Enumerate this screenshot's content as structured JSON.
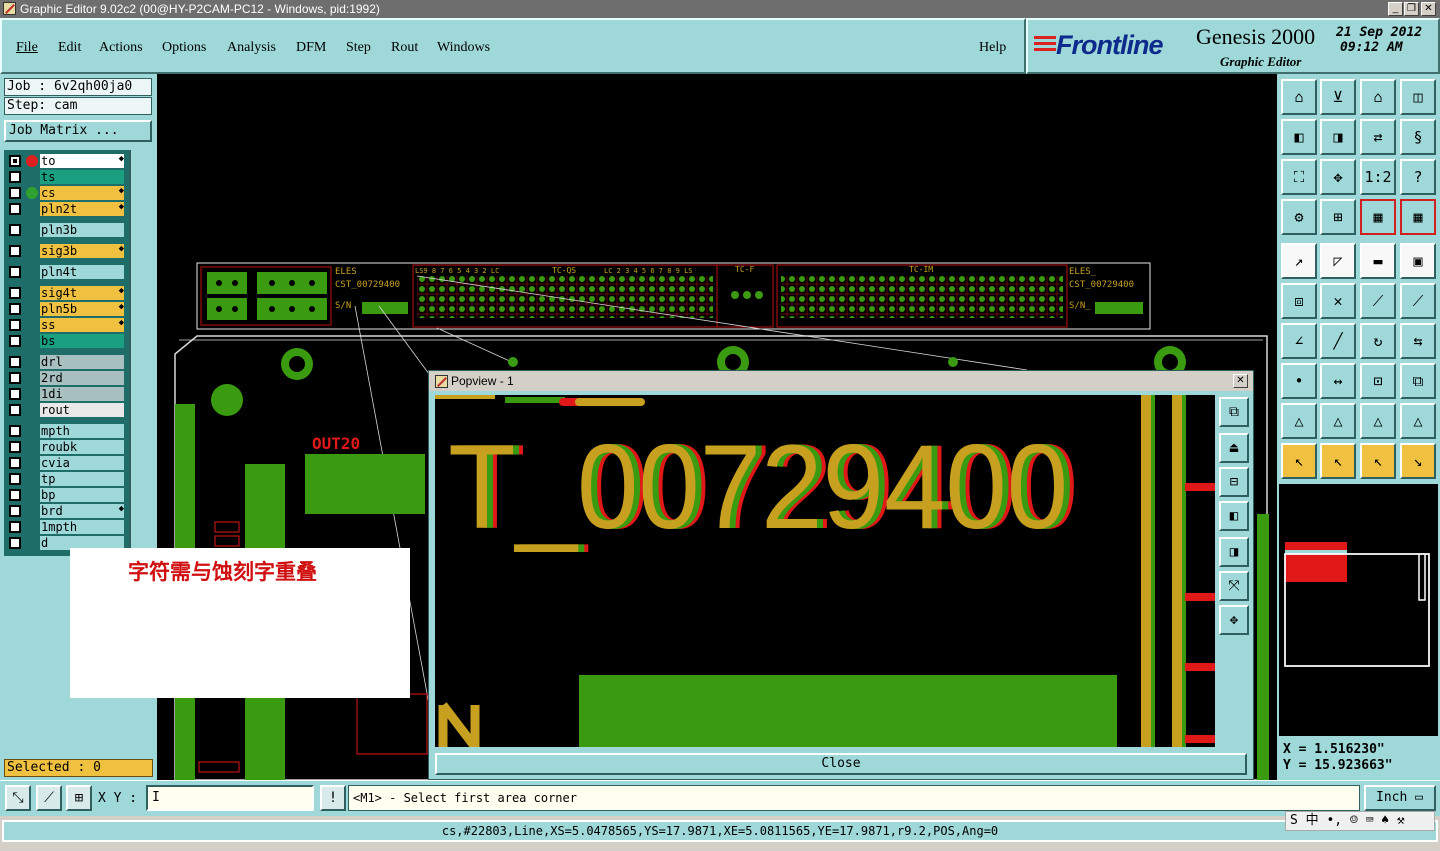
{
  "window": {
    "title": "Graphic Editor 9.02c2 (00@HY-P2CAM-PC12 - Windows, pid:1992)"
  },
  "menu": [
    "File",
    "Edit",
    "Actions",
    "Options",
    "Analysis",
    "DFM",
    "Step",
    "Rout",
    "Windows"
  ],
  "help": "Help",
  "brand": {
    "logo": "Frontline",
    "product": "Genesis 2000",
    "subtitle": "Graphic Editor",
    "date": "21 Sep 2012",
    "time": "09:12 AM"
  },
  "job": {
    "job_line": "Job : 6v2qh00ja0",
    "step_line": "Step: cam",
    "matrix_button": "Job Matrix ..."
  },
  "layers": [
    {
      "name": "to",
      "color": "#ffffff",
      "dot": "#e02020",
      "mark": "◆",
      "sel": true
    },
    {
      "name": "ts",
      "color": "#1aa080",
      "dot": "",
      "mark": ""
    },
    {
      "name": "cs",
      "color": "#f0c040",
      "dot": "#30a030",
      "mark": "◆"
    },
    {
      "name": "pln2t",
      "color": "#f0c040",
      "dot": "",
      "mark": "◆"
    },
    {
      "name": "pln3b",
      "color": "#9ed8d8",
      "dot": "",
      "mark": ""
    },
    {
      "name": "sig3b",
      "color": "#f0c040",
      "dot": "",
      "mark": "◆"
    },
    {
      "name": "pln4t",
      "color": "#9ed8d8",
      "dot": "",
      "mark": ""
    },
    {
      "name": "sig4t",
      "color": "#f0c040",
      "dot": "",
      "mark": "◆"
    },
    {
      "name": "pln5b",
      "color": "#f0c040",
      "dot": "",
      "mark": "◆"
    },
    {
      "name": "ss",
      "color": "#f0c040",
      "dot": "",
      "mark": "◆"
    },
    {
      "name": "bs",
      "color": "#1aa080",
      "dot": "",
      "mark": ""
    },
    {
      "name": "drl",
      "color": "#a8c0c0",
      "dot": "",
      "mark": ""
    },
    {
      "name": "2rd",
      "color": "#a8c0c0",
      "dot": "",
      "mark": ""
    },
    {
      "name": "1di",
      "color": "#a8c0c0",
      "dot": "",
      "mark": ""
    },
    {
      "name": "rout",
      "color": "#e8e8e8",
      "dot": "",
      "mark": ""
    },
    {
      "name": "mpth",
      "color": "#9ed8d8",
      "dot": "",
      "mark": ""
    },
    {
      "name": "roubk",
      "color": "#9ed8d8",
      "dot": "",
      "mark": ""
    },
    {
      "name": "cvia",
      "color": "#9ed8d8",
      "dot": "",
      "mark": ""
    },
    {
      "name": "tp",
      "color": "#9ed8d8",
      "dot": "",
      "mark": ""
    },
    {
      "name": "bp",
      "color": "#9ed8d8",
      "dot": "",
      "mark": ""
    },
    {
      "name": "brd",
      "color": "#9ed8d8",
      "dot": "",
      "mark": "◆"
    },
    {
      "name": "1mpth",
      "color": "#9ed8d8",
      "dot": "",
      "mark": ""
    },
    {
      "name": "d",
      "color": "#9ed8d8",
      "dot": "",
      "mark": ""
    }
  ],
  "selected": "Selected : 0",
  "board_labels": {
    "eles": "ELES",
    "cst": "CST_00729400",
    "sn": "S/N",
    "tcqs": "TC-QS",
    "tcf": "TC-F",
    "tcim": "TC-IM",
    "eles2": "ELES_",
    "cst2": "CST_00729400",
    "sn2": "S/N_",
    "out20": "OUT20",
    "ls": "LS9 8 7 6 5 4 3 2 LC",
    "lc": "LC 2 3 4 5 6 7 8 9 LS"
  },
  "popview": {
    "title": "Popview - 1",
    "big_text": "T_00729400",
    "close": "Close"
  },
  "note": "字符需与蚀刻字重叠",
  "coords": {
    "x": "X = 1.516230\"",
    "y": "Y = 15.923663\""
  },
  "xy_label": "X Y :",
  "xy_value": "I",
  "prompt": "<M1> - Select first area corner",
  "units": "Inch",
  "status": "cs,#22803,Line,XS=5.0478565,YS=17.9871,XE=5.0811565,YE=17.9871,r9.2,POS,Ang=0",
  "ime": "S 中 •, ☺ ⌨ ♠ ⚒",
  "colors": {
    "panel": "#9ed8d8",
    "canvas": "#000000",
    "copper": "#3a9a10",
    "silk": "#c8a020",
    "red": "#e01818"
  },
  "icons": [
    "window-minimize-icon",
    "window-restore-icon",
    "window-close-icon"
  ]
}
